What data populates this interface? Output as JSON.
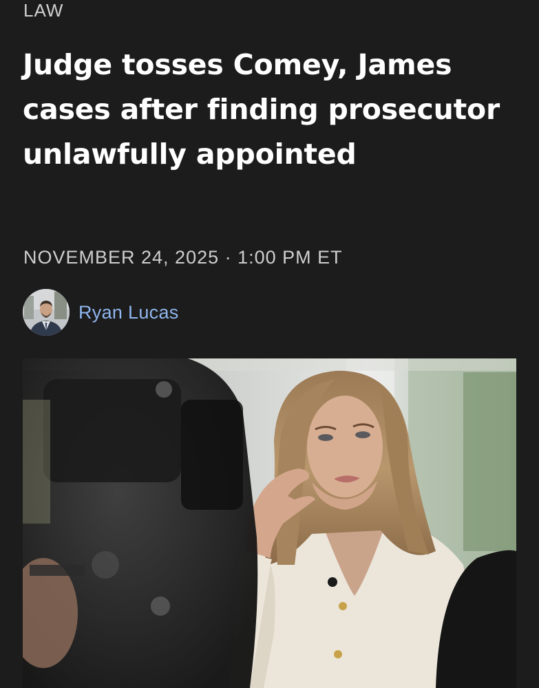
{
  "section": "LAW",
  "headline": "Judge tosses Comey, James cases after finding prosecutor unlawfully appointed",
  "dateline": "NOVEMBER 24, 2025 · 1:00 PM ET",
  "author": {
    "name": "Ryan Lucas"
  },
  "colors": {
    "background": "#1c1c1c",
    "headline": "#ffffff",
    "meta": "#cfcfcf",
    "author_link": "#8fb6ee"
  }
}
